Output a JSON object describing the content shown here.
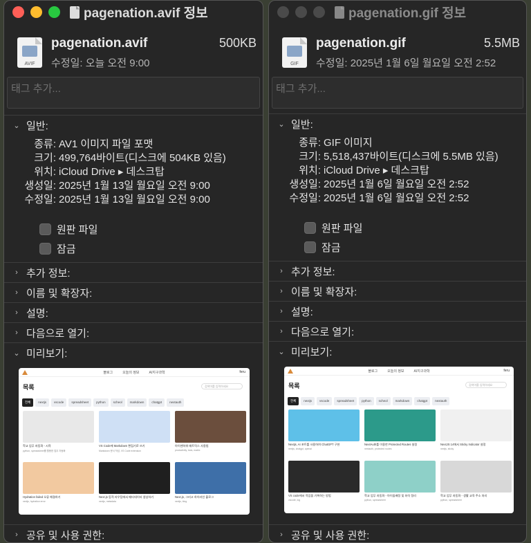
{
  "left": {
    "title": "pagenation.avif 정보",
    "file_name": "pagenation.avif",
    "file_size": "500KB",
    "modified_short": "수정일: 오늘 오전 9:00",
    "icon_ext": "AVIF",
    "tags_placeholder": "태그 추가...",
    "general_label": "일반:",
    "info": [
      {
        "key": "종류:",
        "value": "AV1 이미지 파일 포맷"
      },
      {
        "key": "크기:",
        "value": "499,764바이트(디스크에 504KB 있음)"
      },
      {
        "key": "위치:",
        "value": "iCloud Drive ▸ 데스크탑"
      },
      {
        "key": "생성일:",
        "value": "2025년 1월 13일 월요일 오전 9:00"
      },
      {
        "key": "수정일:",
        "value": "2025년 1월 13일 월요일 오전 9:00"
      }
    ],
    "stationery_label": "원판 파일",
    "locked_label": "잠금",
    "sections": [
      "추가 정보:",
      "이름 및 확장자:",
      "설명:",
      "다음으로 열기:"
    ],
    "preview_label": "미리보기:",
    "sharing_label": "공유 및 사용 권한:"
  },
  "right": {
    "title": "pagenation.gif 정보",
    "file_name": "pagenation.gif",
    "file_size": "5.5MB",
    "modified_short": "수정일: 2025년 1월 6일 월요일 오전 2:52",
    "icon_ext": "GIF",
    "tags_placeholder": "태그 추가...",
    "general_label": "일반:",
    "info": [
      {
        "key": "종류:",
        "value": "GIF 이미지"
      },
      {
        "key": "크기:",
        "value": "5,518,437바이트(디스크에 5.5MB 있음)"
      },
      {
        "key": "위치:",
        "value": "iCloud Drive ▸ 데스크탑"
      },
      {
        "key": "생성일:",
        "value": "2025년 1월 6일 월요일 오전 2:52"
      },
      {
        "key": "수정일:",
        "value": "2025년 1월 6일 월요일 오전 2:52"
      }
    ],
    "stationery_label": "원판 파일",
    "locked_label": "잠금",
    "sections": [
      "추가 정보:",
      "이름 및 확장자:",
      "설명:",
      "다음으로 열기:"
    ],
    "preview_label": "미리보기:",
    "sharing_label": "공유 및 사용 권한:"
  },
  "preview": {
    "nav": [
      "블로그",
      "오늘의 정보",
      "AI지구과학"
    ],
    "user": "feru",
    "page_title": "목록",
    "search_placeholder": "검색어를 입력하세요",
    "tags": [
      "전체",
      "nextjs",
      "vscode",
      "spreadsheet",
      "python",
      "scheol",
      "markdown",
      "chatgpt",
      "nextauth"
    ],
    "left_cards": [
      {
        "caption": "학교 업무 자동화 - 시작",
        "sub": "python, spreadsheet를 활용한 업무 자동화",
        "color": "#e8e8e8"
      },
      {
        "caption": "VS Code에 Markdown 편집기로 쓰기",
        "sub": "Markdown 문서 작성, VS Code extension",
        "color": "#cfe0f5"
      },
      {
        "caption": "아이젠하워 매트릭스 사용법",
        "sub": "productivity, todo, matrix",
        "color": "#6b4e3d"
      },
      {
        "caption": "Hydration failed 오류 해결하기",
        "sub": "nextjs, hydration error",
        "color": "#f2c9a0"
      },
      {
        "caption": "Next.js 동적 라우팅에서 메타데이터 생성하기",
        "sub": "nextjs, metadata",
        "color": "#1f1f1f"
      },
      {
        "caption": "Next.js, 그리고 하이라인 블로그",
        "sub": "nextjs, blog",
        "color": "#3e6fa8"
      }
    ],
    "right_cards": [
      {
        "caption": "Nextjs, AI 포트를 사용하여 ChatGPT 구현",
        "sub": "nextjs, chatgpt, openai",
        "color": "#5ec0e8"
      },
      {
        "caption": "NextAuth를 이용한 Protected Routes 설정",
        "sub": "nextauth, protected routes",
        "color": "#2c9a8a"
      },
      {
        "caption": "NextJS 14에서 Sticky Indicator 설정",
        "sub": "nextjs, sticky",
        "color": "#f0f0f0"
      },
      {
        "caption": "VS code에서 작업을 기록하는 방법",
        "sub": "vscode, log",
        "color": "#2a2a2a"
      },
      {
        "caption": "학교 업무 자동화 - 아이들배정 및 좌석 정리",
        "sub": "python, spreadsheet",
        "color": "#8ed0c8"
      },
      {
        "caption": "학교 업무 자동화 - 생활 교육 주소 처리",
        "sub": "python, spreadsheet",
        "color": "#d8d8d8"
      }
    ]
  }
}
